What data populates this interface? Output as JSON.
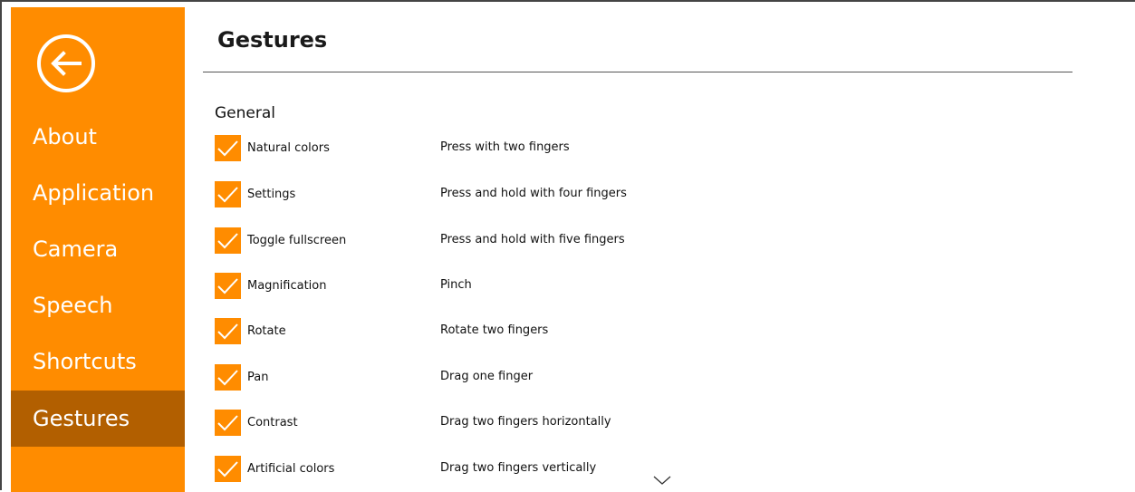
{
  "window": {
    "accent_color": "#ff8c00",
    "selected_color": "#b25f00"
  },
  "sidebar": {
    "back_icon": "back-arrow-circle-icon",
    "items": [
      {
        "label": "About",
        "selected": false
      },
      {
        "label": "Application",
        "selected": false
      },
      {
        "label": "Camera",
        "selected": false
      },
      {
        "label": "Speech",
        "selected": false
      },
      {
        "label": "Shortcuts",
        "selected": false
      },
      {
        "label": "Gestures",
        "selected": true
      }
    ]
  },
  "main": {
    "title": "Gestures",
    "section": "General",
    "gestures": [
      {
        "name": "Natural colors",
        "action": "Press with two fingers",
        "checked": true
      },
      {
        "name": "Settings",
        "action": "Press and hold with four fingers",
        "checked": true
      },
      {
        "name": "Toggle fullscreen",
        "action": "Press and hold with five fingers",
        "checked": true
      },
      {
        "name": "Magnification",
        "action": "Pinch",
        "checked": true
      },
      {
        "name": "Rotate",
        "action": "Rotate two fingers",
        "checked": true
      },
      {
        "name": "Pan",
        "action": "Drag one finger",
        "checked": true
      },
      {
        "name": "Contrast",
        "action": "Drag two fingers horizontally",
        "checked": true
      },
      {
        "name": "Artificial colors",
        "action": "Drag two fingers vertically",
        "checked": true
      }
    ],
    "scroll_icon": "chevron-down-icon"
  }
}
